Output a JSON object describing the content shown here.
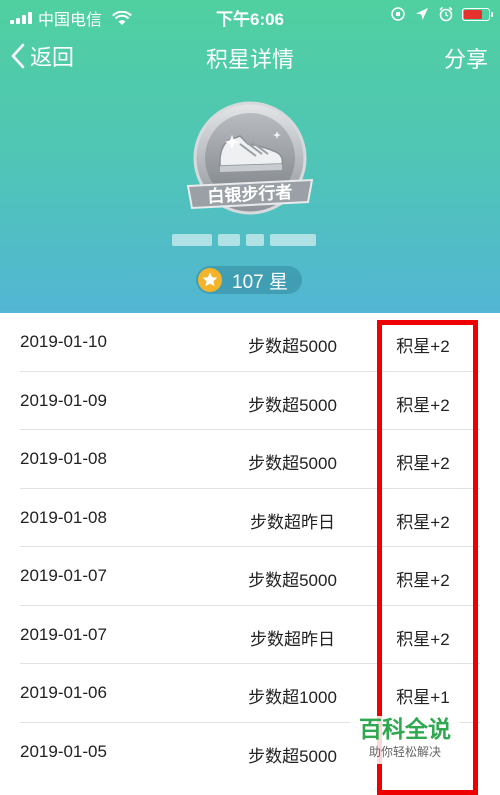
{
  "status_bar": {
    "carrier": "中国电信",
    "time": "下午6:06"
  },
  "nav": {
    "back_label": "返回",
    "title": "积星详情",
    "share_label": "分享"
  },
  "badge": {
    "title": "白银步行者"
  },
  "stars": {
    "count_label": "107 星"
  },
  "records": [
    {
      "date": "2019-01-10",
      "reason": "步数超5000",
      "points": "积星+2"
    },
    {
      "date": "2019-01-09",
      "reason": "步数超5000",
      "points": "积星+2"
    },
    {
      "date": "2019-01-08",
      "reason": "步数超5000",
      "points": "积星+2"
    },
    {
      "date": "2019-01-08",
      "reason": "步数超昨日",
      "points": "积星+2"
    },
    {
      "date": "2019-01-07",
      "reason": "步数超5000",
      "points": "积星+2"
    },
    {
      "date": "2019-01-07",
      "reason": "步数超昨日",
      "points": "积星+2"
    },
    {
      "date": "2019-01-06",
      "reason": "步数超1000",
      "points": "积星+1"
    },
    {
      "date": "2019-01-05",
      "reason": "步数超5000",
      "points": ""
    }
  ],
  "watermark": {
    "title": "百科全说",
    "subtitle": "助你轻松解决"
  },
  "colors": {
    "header_gradient_top": "#50d0a0",
    "header_gradient_bottom": "#52b6d4",
    "highlight_box": "#ee0000",
    "star": "#f5b32a",
    "watermark_green": "#2fa84f"
  }
}
